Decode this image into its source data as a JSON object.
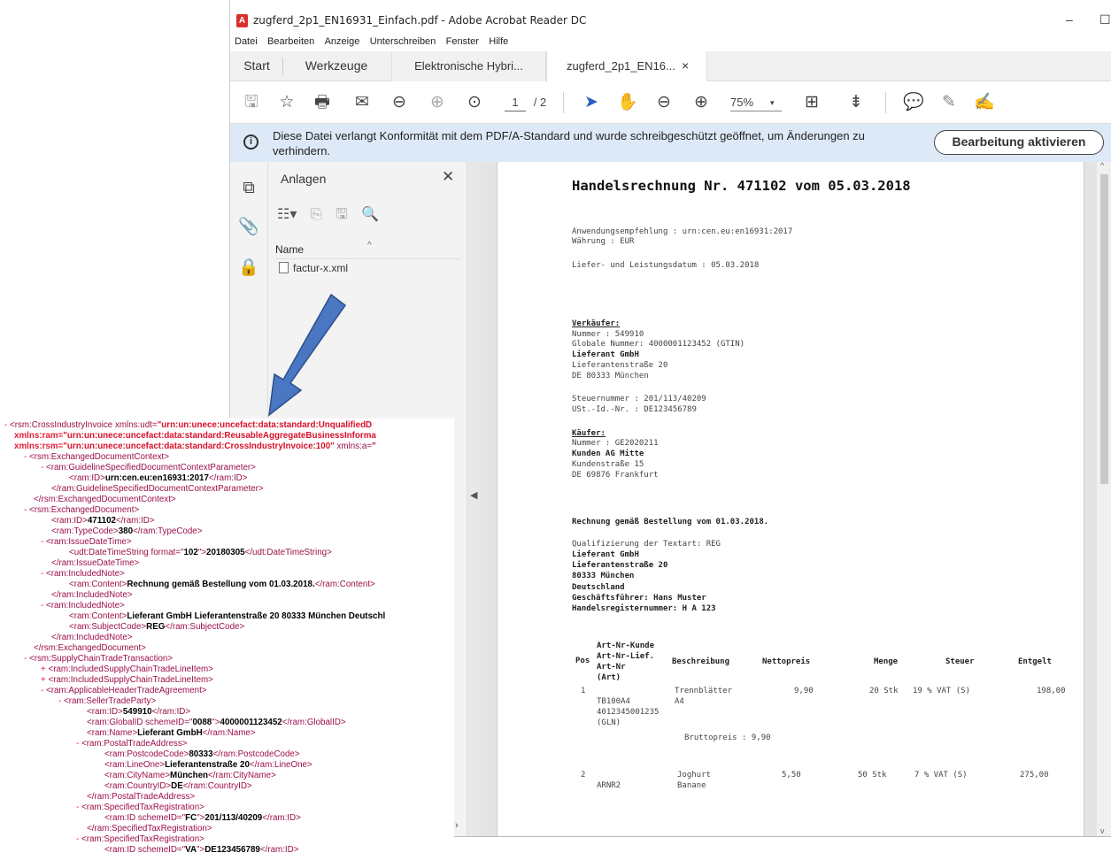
{
  "window": {
    "title": "zugferd_2p1_EN16931_Einfach.pdf - Adobe Acrobat Reader DC"
  },
  "menu": [
    "Datei",
    "Bearbeiten",
    "Anzeige",
    "Unterschreiben",
    "Fenster",
    "Hilfe"
  ],
  "tabs": {
    "start": "Start",
    "tools": "Werkzeuge",
    "hybrid": "Elektronische Hybri...",
    "doc": "zugferd_2p1_EN16...",
    "doc_close": "×"
  },
  "toolbar": {
    "page_current": "1",
    "page_total": "/ 2",
    "zoom": "75%"
  },
  "infobar": {
    "message": "Diese Datei verlangt Konformität mit dem PDF/A-Standard und wurde schreibgeschützt geöffnet, um Änderungen zu verhindern.",
    "button": "Bearbeitung aktivieren"
  },
  "panel": {
    "title": "Anlagen",
    "column": "Name",
    "file": "factur-x.xml"
  },
  "doc": {
    "title": "Handelsrechnung Nr. 471102 vom 05.03.2018",
    "l1": "Anwendungsempfehlung : urn:cen.eu:en16931:2017",
    "l2": "Währung              : EUR",
    "l3": "Liefer- und Leistungsdatum    : 05.03.2018",
    "seller_head": "Verkäufer:",
    "s1": "Nummer         : 549910",
    "s2": "Globale Nummer: 4000001123452 (GTIN)",
    "s3": "Lieferant GmbH",
    "s4": "Lieferantenstraße 20",
    "s5": "DE 80333 München",
    "s6": "Steuernummer : 201/113/40209",
    "s7": "USt.-Id.-Nr. : DE123456789",
    "buyer_head": "Käufer:",
    "k1": "Nummer         : GE2020211",
    "k2": "Kunden AG Mitte",
    "k3": "Kundenstraße 15",
    "k4": "DE 69876 Frankfurt",
    "order": "Rechnung gemäß Bestellung vom 01.03.2018.",
    "q1": "Qualifizierung der Textart: REG",
    "q2": "Lieferant GmbH",
    "q3": "Lieferantenstraße 20",
    "q4": "80333 München",
    "q5": "Deutschland",
    "q6": "Geschäftsführer: Hans Muster",
    "q7": "Handelsregisternummer: H A 123",
    "th_pos": "Pos",
    "th_art1": "Art-Nr-Kunde",
    "th_art2": "Art-Nr-Lief.",
    "th_art3": "Art-Nr",
    "th_art4": "(Art)",
    "th_desc": "Beschreibung",
    "th_net": "Nettopreis",
    "th_qty": "Menge",
    "th_tax": "Steuer",
    "th_amt": "Entgelt",
    "r1_pos": "1",
    "r1_art1": "TB100A4",
    "r1_art2": "4012345001235",
    "r1_art3": "(GLN)",
    "r1_desc1": "Trennblätter",
    "r1_desc2": "A4",
    "r1_net": "9,90",
    "r1_qty": "20 Stk",
    "r1_tax": "19 % VAT (S)",
    "r1_amt": "198,00",
    "r1_gross": "Bruttopreis : 9,90",
    "r2_pos": "2",
    "r2_art1": "ARNR2",
    "r2_desc1": "Joghurt",
    "r2_desc2": "Banane",
    "r2_net": "5,50",
    "r2_qty": "50 Stk",
    "r2_tax": "7 % VAT (S)",
    "r2_amt": "275,00"
  },
  "xml": {
    "x01": "<rsm:CrossIndustryInvoice",
    "x01a": " xmlns:udt=",
    "x01b": "\"urn:un:unece:uncefact:data:standard:UnqualifiedD",
    "x02a": "xmlns:ram=",
    "x02b": "\"urn:un:unece:uncefact:data:standard:ReusableAggregateBusinessInforma",
    "x03a": "xmlns:rsm=",
    "x03b": "\"urn:un:unece:uncefact:data:standard:CrossIndustryInvoice:100\"",
    "x03c": " xmlns:a=",
    "x03d": "\"",
    "x04": "<rsm:ExchangedDocumentContext>",
    "x05": "<ram:GuidelineSpecifiedDocumentContextParameter>",
    "x06a": "<ram:ID>",
    "x06b": "urn:cen.eu:en16931:2017",
    "x06c": "</ram:ID>",
    "x07": "</ram:GuidelineSpecifiedDocumentContextParameter>",
    "x08": "</rsm:ExchangedDocumentContext>",
    "x09": "<rsm:ExchangedDocument>",
    "x10a": "<ram:ID>",
    "x10b": "471102",
    "x10c": "</ram:ID>",
    "x11a": "<ram:TypeCode>",
    "x11b": "380",
    "x11c": "</ram:TypeCode>",
    "x12": "<ram:IssueDateTime>",
    "x13a": "<udt:DateTimeString format=\"",
    "x13b": "102",
    "x13c": "\">",
    "x13d": "20180305",
    "x13e": "</udt:DateTimeString>",
    "x14": "</ram:IssueDateTime>",
    "x15": "<ram:IncludedNote>",
    "x16a": "<ram:Content>",
    "x16b": "Rechnung gemäß Bestellung vom 01.03.2018.",
    "x16c": "</ram:Content>",
    "x17": "</ram:IncludedNote>",
    "x18": "<ram:IncludedNote>",
    "x19a": "<ram:Content>",
    "x19b": "Lieferant GmbH Lieferantenstraße 20 80333 München Deutschl",
    "x20a": "<ram:SubjectCode>",
    "x20b": "REG",
    "x20c": "</ram:SubjectCode>",
    "x21": "</ram:IncludedNote>",
    "x22": "</rsm:ExchangedDocument>",
    "x23": "<rsm:SupplyChainTradeTransaction>",
    "x24": "<ram:IncludedSupplyChainTradeLineItem>",
    "x25": "<ram:IncludedSupplyChainTradeLineItem>",
    "x26": "<ram:ApplicableHeaderTradeAgreement>",
    "x27": "<ram:SellerTradeParty>",
    "x28a": "<ram:ID>",
    "x28b": "549910",
    "x28c": "</ram:ID>",
    "x29a": "<ram:GlobalID schemeID=\"",
    "x29b": "0088",
    "x29c": "\">",
    "x29d": "4000001123452",
    "x29e": "</ram:GlobalID>",
    "x30a": "<ram:Name>",
    "x30b": "Lieferant GmbH",
    "x30c": "</ram:Name>",
    "x31": "<ram:PostalTradeAddress>",
    "x32a": "<ram:PostcodeCode>",
    "x32b": "80333",
    "x32c": "</ram:PostcodeCode>",
    "x33a": "<ram:LineOne>",
    "x33b": "Lieferantenstraße 20",
    "x33c": "</ram:LineOne>",
    "x34a": "<ram:CityName>",
    "x34b": "München",
    "x34c": "</ram:CityName>",
    "x35a": "<ram:CountryID>",
    "x35b": "DE",
    "x35c": "</ram:CountryID>",
    "x36": "</ram:PostalTradeAddress>",
    "x37": "<ram:SpecifiedTaxRegistration>",
    "x38a": "<ram:ID schemeID=\"",
    "x38b": "FC",
    "x38c": "\">",
    "x38d": "201/113/40209",
    "x38e": "</ram:ID>",
    "x39": "</ram:SpecifiedTaxRegistration>",
    "x40": "<ram:SpecifiedTaxRegistration>",
    "x41a": "<ram:ID schemeID=\"",
    "x41b": "VA",
    "x41c": "\">",
    "x41d": "DE123456789",
    "x41e": "</ram:ID>",
    "minus": "-",
    "plus": "+"
  },
  "colors": {
    "infobar_bg": "#dde9f7",
    "arrow_fill": "#4a77c2",
    "xml_markup": "#e0213a",
    "xml_tag": "#9b0f4b"
  }
}
